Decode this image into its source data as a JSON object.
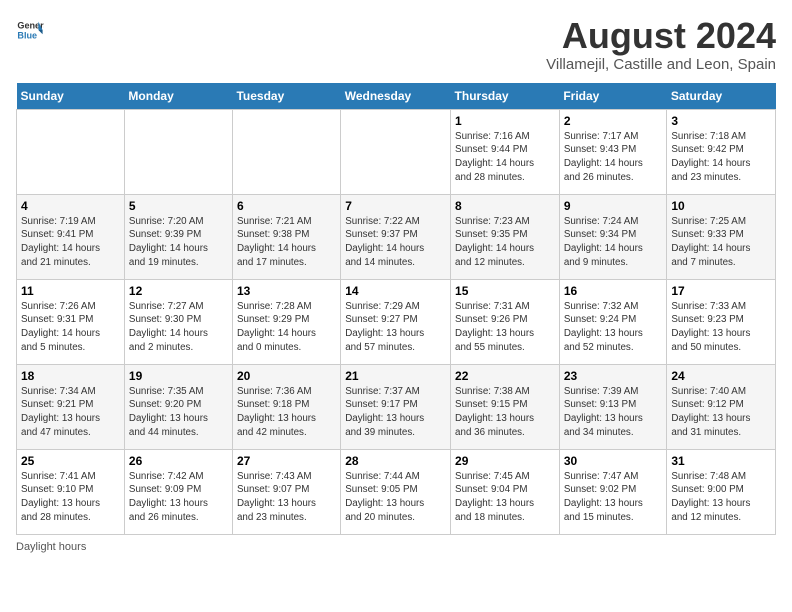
{
  "logo": {
    "general": "General",
    "blue": "Blue"
  },
  "title": "August 2024",
  "subtitle": "Villamejil, Castille and Leon, Spain",
  "days_of_week": [
    "Sunday",
    "Monday",
    "Tuesday",
    "Wednesday",
    "Thursday",
    "Friday",
    "Saturday"
  ],
  "footer": "Daylight hours",
  "weeks": [
    [
      {
        "day": "",
        "info": ""
      },
      {
        "day": "",
        "info": ""
      },
      {
        "day": "",
        "info": ""
      },
      {
        "day": "",
        "info": ""
      },
      {
        "day": "1",
        "info": "Sunrise: 7:16 AM\nSunset: 9:44 PM\nDaylight: 14 hours\nand 28 minutes."
      },
      {
        "day": "2",
        "info": "Sunrise: 7:17 AM\nSunset: 9:43 PM\nDaylight: 14 hours\nand 26 minutes."
      },
      {
        "day": "3",
        "info": "Sunrise: 7:18 AM\nSunset: 9:42 PM\nDaylight: 14 hours\nand 23 minutes."
      }
    ],
    [
      {
        "day": "4",
        "info": "Sunrise: 7:19 AM\nSunset: 9:41 PM\nDaylight: 14 hours\nand 21 minutes."
      },
      {
        "day": "5",
        "info": "Sunrise: 7:20 AM\nSunset: 9:39 PM\nDaylight: 14 hours\nand 19 minutes."
      },
      {
        "day": "6",
        "info": "Sunrise: 7:21 AM\nSunset: 9:38 PM\nDaylight: 14 hours\nand 17 minutes."
      },
      {
        "day": "7",
        "info": "Sunrise: 7:22 AM\nSunset: 9:37 PM\nDaylight: 14 hours\nand 14 minutes."
      },
      {
        "day": "8",
        "info": "Sunrise: 7:23 AM\nSunset: 9:35 PM\nDaylight: 14 hours\nand 12 minutes."
      },
      {
        "day": "9",
        "info": "Sunrise: 7:24 AM\nSunset: 9:34 PM\nDaylight: 14 hours\nand 9 minutes."
      },
      {
        "day": "10",
        "info": "Sunrise: 7:25 AM\nSunset: 9:33 PM\nDaylight: 14 hours\nand 7 minutes."
      }
    ],
    [
      {
        "day": "11",
        "info": "Sunrise: 7:26 AM\nSunset: 9:31 PM\nDaylight: 14 hours\nand 5 minutes."
      },
      {
        "day": "12",
        "info": "Sunrise: 7:27 AM\nSunset: 9:30 PM\nDaylight: 14 hours\nand 2 minutes."
      },
      {
        "day": "13",
        "info": "Sunrise: 7:28 AM\nSunset: 9:29 PM\nDaylight: 14 hours\nand 0 minutes."
      },
      {
        "day": "14",
        "info": "Sunrise: 7:29 AM\nSunset: 9:27 PM\nDaylight: 13 hours\nand 57 minutes."
      },
      {
        "day": "15",
        "info": "Sunrise: 7:31 AM\nSunset: 9:26 PM\nDaylight: 13 hours\nand 55 minutes."
      },
      {
        "day": "16",
        "info": "Sunrise: 7:32 AM\nSunset: 9:24 PM\nDaylight: 13 hours\nand 52 minutes."
      },
      {
        "day": "17",
        "info": "Sunrise: 7:33 AM\nSunset: 9:23 PM\nDaylight: 13 hours\nand 50 minutes."
      }
    ],
    [
      {
        "day": "18",
        "info": "Sunrise: 7:34 AM\nSunset: 9:21 PM\nDaylight: 13 hours\nand 47 minutes."
      },
      {
        "day": "19",
        "info": "Sunrise: 7:35 AM\nSunset: 9:20 PM\nDaylight: 13 hours\nand 44 minutes."
      },
      {
        "day": "20",
        "info": "Sunrise: 7:36 AM\nSunset: 9:18 PM\nDaylight: 13 hours\nand 42 minutes."
      },
      {
        "day": "21",
        "info": "Sunrise: 7:37 AM\nSunset: 9:17 PM\nDaylight: 13 hours\nand 39 minutes."
      },
      {
        "day": "22",
        "info": "Sunrise: 7:38 AM\nSunset: 9:15 PM\nDaylight: 13 hours\nand 36 minutes."
      },
      {
        "day": "23",
        "info": "Sunrise: 7:39 AM\nSunset: 9:13 PM\nDaylight: 13 hours\nand 34 minutes."
      },
      {
        "day": "24",
        "info": "Sunrise: 7:40 AM\nSunset: 9:12 PM\nDaylight: 13 hours\nand 31 minutes."
      }
    ],
    [
      {
        "day": "25",
        "info": "Sunrise: 7:41 AM\nSunset: 9:10 PM\nDaylight: 13 hours\nand 28 minutes."
      },
      {
        "day": "26",
        "info": "Sunrise: 7:42 AM\nSunset: 9:09 PM\nDaylight: 13 hours\nand 26 minutes."
      },
      {
        "day": "27",
        "info": "Sunrise: 7:43 AM\nSunset: 9:07 PM\nDaylight: 13 hours\nand 23 minutes."
      },
      {
        "day": "28",
        "info": "Sunrise: 7:44 AM\nSunset: 9:05 PM\nDaylight: 13 hours\nand 20 minutes."
      },
      {
        "day": "29",
        "info": "Sunrise: 7:45 AM\nSunset: 9:04 PM\nDaylight: 13 hours\nand 18 minutes."
      },
      {
        "day": "30",
        "info": "Sunrise: 7:47 AM\nSunset: 9:02 PM\nDaylight: 13 hours\nand 15 minutes."
      },
      {
        "day": "31",
        "info": "Sunrise: 7:48 AM\nSunset: 9:00 PM\nDaylight: 13 hours\nand 12 minutes."
      }
    ]
  ]
}
